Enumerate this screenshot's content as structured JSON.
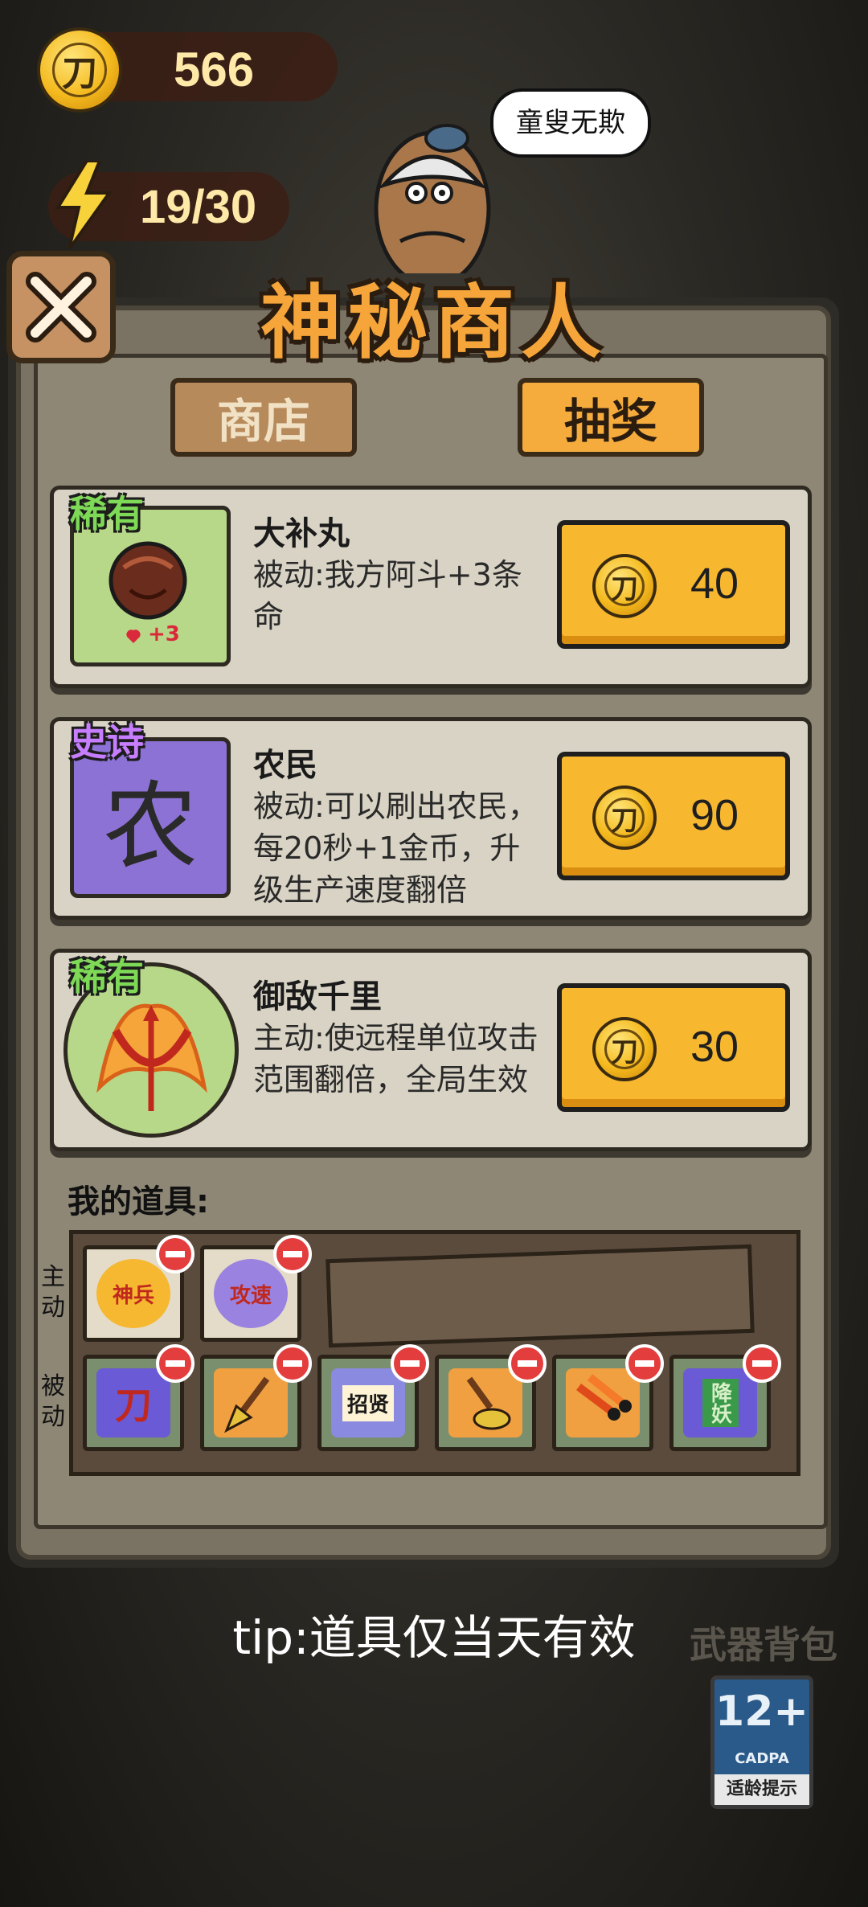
{
  "hud": {
    "coins": "566",
    "energy": "19/30",
    "coin_glyph": "刀"
  },
  "merchant": {
    "speech": "童叟无欺"
  },
  "dialog": {
    "title": "神秘商人",
    "tabs": [
      {
        "label": "商店",
        "active": false
      },
      {
        "label": "抽奖",
        "active": true
      }
    ]
  },
  "items": [
    {
      "rarity": "稀有",
      "rarity_color": "#7ed957",
      "name": "大补丸",
      "desc": "被动:我方阿斗+3条命",
      "price": "40",
      "icon_badge": "+3",
      "icon": "pill-icon"
    },
    {
      "rarity": "史诗",
      "rarity_color": "#c77dff",
      "name": "农民",
      "desc": "被动:可以刷出农民，每20秒+1金币，升级生产速度翻倍",
      "price": "90",
      "icon_glyph": "农",
      "icon": "farmer-icon"
    },
    {
      "rarity": "稀有",
      "rarity_color": "#7ed957",
      "name": "御敌千里",
      "desc": "主动:使远程单位攻击范围翻倍，全局生效",
      "price": "30",
      "icon": "flaming-bow-icon"
    }
  ],
  "inventory": {
    "label": "我的道具:",
    "active_label": "主动",
    "passive_label": "被动",
    "active_items": [
      {
        "name": "神兵",
        "icon": "divine-weapon-icon"
      },
      {
        "name": "攻速",
        "icon": "attack-speed-icon"
      }
    ],
    "passive_items": [
      {
        "name": "刀",
        "icon": "blade-icon"
      },
      {
        "name": "",
        "icon": "shovel-icon"
      },
      {
        "name": "招贤",
        "icon": "recruit-scroll-icon"
      },
      {
        "name": "",
        "icon": "dig-icon"
      },
      {
        "name": "",
        "icon": "fire-arrows-icon"
      },
      {
        "name": "降妖",
        "icon": "demon-seal-icon"
      }
    ]
  },
  "tip": "tip:道具仅当天有效",
  "weapon_bag": "武器背包",
  "age_rating": {
    "num": "12+",
    "org": "CADPA",
    "hint": "适龄提示"
  },
  "colors": {
    "title": "#f5a53a",
    "price_button": "#f7b830",
    "rare": "#7ed957",
    "epic": "#c77dff"
  }
}
